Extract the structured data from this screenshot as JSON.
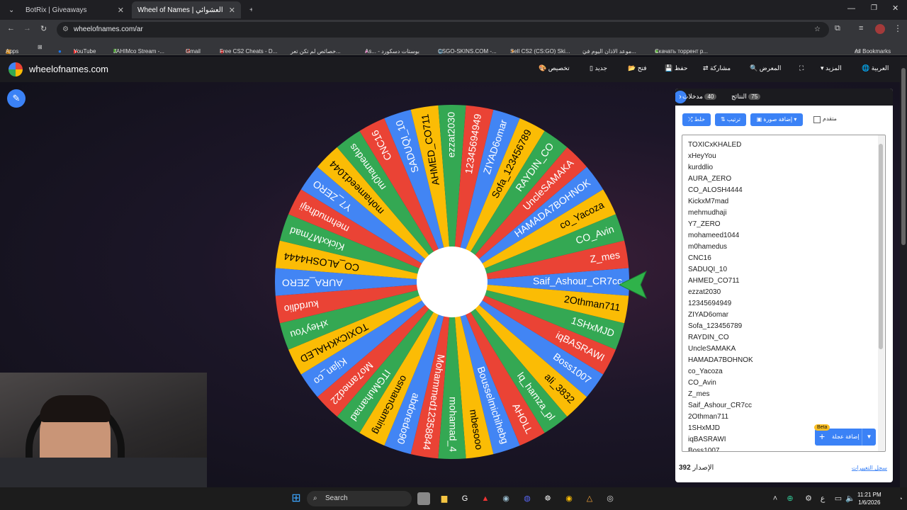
{
  "browser": {
    "tabs": [
      {
        "title": "BotRix | Giveaways",
        "active": false
      },
      {
        "title": "Wheel of Names | اسم العشوائي",
        "active": true
      }
    ],
    "url": "wheelofnames.com/ar",
    "bookmarks": [
      "Apps",
      "YouTube",
      "JAHIMco Stream -...",
      "Gmail",
      "Free CS2 Cheats - D...",
      "خصائص لم تكن تعر...",
      "As... - بوستات دسكورد",
      "CSGO-SKINS.COM -...",
      "Sell CS2 (CS:GO) Ski...",
      "موعد الاذان اليوم في...",
      "Скачать торрент р...",
      "All Bookmarks"
    ]
  },
  "site": {
    "title": "wheelofnames.com",
    "nav": [
      "تخصيص",
      "جديد",
      "فتح",
      "حفظ",
      "مشاركة",
      "المعرض",
      "المزيد",
      "العربية"
    ]
  },
  "panel": {
    "entries_tab": {
      "label": "مدخلات",
      "count": "40"
    },
    "results_tab": {
      "label": "النتائج",
      "count": "75"
    },
    "buttons": {
      "shuffle": "خلط",
      "sort": "ترتيب",
      "add_image": "إضافة صورة",
      "advanced": "متقدم"
    },
    "entries": [
      "TOXICxKHALED",
      "xHeyYou",
      "kurddlio",
      "AURA_ZERO",
      "CO_ALOSH4444",
      "KickxM7mad",
      "mehmudhaji",
      "Y7_ZERO",
      "mohameed1044",
      "m0hamedus",
      "CNC16",
      "SADUQI_10",
      "AHMED_CO711",
      "ezzat2030",
      "12345694949",
      "ZIYAD6omar",
      "Sofa_123456789",
      "RAYDIN_CO",
      "UncleSAMAKA",
      "HAMADA7BOHNOK",
      "co_Yacoza",
      "CO_Avin",
      "Z_mes",
      "Saif_Ashour_CR7cc",
      "2Othman711",
      "1SHxMJD",
      "iqBASRAWI",
      "Boss1007"
    ],
    "add_wheel": "إضافة عجلة",
    "beta": "Beta",
    "version_label": "الإصدار",
    "version_value": "392",
    "changelog": "سجل التغييرات"
  },
  "wheel": {
    "colors": [
      "#4285f4",
      "#fbbc05",
      "#34a853",
      "#ea4335"
    ],
    "slices": [
      "Saif_Ashour_CR7cc",
      "2Othman711",
      "1SHxMJD",
      "iqBASRAWI",
      "Boss1007",
      "ali_3832",
      "lq_hamza_pl",
      "AHOLL",
      "Bousselmichihebg",
      "mbesooo",
      "mohamad_4",
      "Mohammed12358844",
      "abdoredo90",
      "osmanGaming",
      "ITGMuhamad",
      "Mo7amed22",
      "Kijan_co",
      "TOXICxKHALED",
      "xHeyYou",
      "kurddlio",
      "AURA_ZERO",
      "CO_ALOSH4444",
      "KickxM7mad",
      "mehmudhaji",
      "Y7_ZERO",
      "mohameed1044",
      "m0hamedus",
      "CNC16",
      "SADUQI_10",
      "AHMED_CO711",
      "ezzat2030",
      "12345694949",
      "ZIYAD6omar",
      "Sofa_123456789",
      "RAYDIN_CO",
      "UncleSAMAKA",
      "HAMADA7BOHNOK",
      "co_Yacoza",
      "CO_Avin",
      "Z_mes"
    ]
  },
  "taskbar": {
    "search": "Search",
    "time": "11:21 PM",
    "date": "1/6/2026"
  }
}
